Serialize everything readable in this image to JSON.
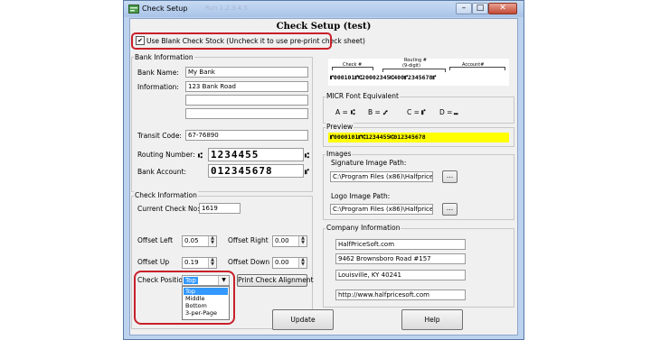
{
  "window": {
    "title": "Check Setup",
    "bg_text": "Run  1.2.3.4.5",
    "minimize": "–",
    "maximize": "□",
    "close": "✕"
  },
  "heading": "Check Setup (test)",
  "blank_stock": {
    "checked_mark": "✔",
    "label": "Use Blank Check Stock (Uncheck it to use pre-print check sheet)"
  },
  "bank": {
    "group_label": "Bank Information",
    "name_label": "Bank Name:",
    "name_value": "My Bank",
    "info_label": "Information:",
    "info_lines": [
      "123 Bank Road",
      "",
      ""
    ],
    "transit_label": "Transit Code:",
    "transit_value": "67-76890",
    "routing_label": "Routing Number:",
    "routing_prefix": "⑆",
    "routing_value": "1234455",
    "routing_suffix": "⑆",
    "account_label": "Bank Account:",
    "account_value": "012345678",
    "account_suffix": "⑈"
  },
  "micr_sample": {
    "check_label": "Check #",
    "routing_label": "Routing #",
    "routing_sub": "(9-digit)",
    "account_label": "Account#",
    "sample_text": "⑈000101⑈⑆20002345⑆400⑈2345678⑈"
  },
  "micr_font": {
    "group_label": "MICR Font Equivalent",
    "items": [
      {
        "letter": "A =",
        "symbol": "⑆"
      },
      {
        "letter": "B =",
        "symbol": "⑇"
      },
      {
        "letter": "C =",
        "symbol": "⑈"
      },
      {
        "letter": "D =",
        "symbol": "⑉"
      }
    ]
  },
  "preview": {
    "group_label": "Preview",
    "text": "⑈0000101⑈⑆1234455⑆012345678"
  },
  "images": {
    "group_label": "Images",
    "signature_label": "Signature Image Path:",
    "signature_path": "C:\\Program Files (x86)\\Halfpricesoft\\e",
    "logo_label": "Logo Image Path:",
    "logo_path": "C:\\Program Files (x86)\\Halfpricesoft\\e",
    "browse_label": "..."
  },
  "check_info": {
    "group_label": "Check Information",
    "current_label": "Current Check No:",
    "current_value": "1619",
    "offset_left_label": "Offset Left",
    "offset_left_value": "0.05",
    "offset_right_label": "Offset Right",
    "offset_right_value": "0.00",
    "offset_up_label": "Offset Up",
    "offset_up_value": "0.19",
    "offset_down_label": "Offset Down",
    "offset_down_value": "0.00",
    "position_label": "Check Position",
    "position_selected": "Top",
    "position_options": [
      "Top",
      "Middle",
      "Bottom",
      "3-per-Page"
    ],
    "align_button": "Print Check Alignment"
  },
  "company": {
    "group_label": "Company Information",
    "lines": [
      "HalfPriceSoft.com",
      "9462 Brownsboro Road #157",
      "Louisville, KY 40241",
      "http://www.halfpricesoft.com"
    ]
  },
  "buttons": {
    "update": "Update",
    "help": "Help"
  },
  "colors": {
    "title_bar": "#a9c4e8",
    "preview_bg": "#ffff00",
    "highlight_border": "#c8202a",
    "list_selection": "#3399ff"
  },
  "icons": {
    "app": "checkbook-icon",
    "spin": "spin-arrows-icon",
    "dropdown": "chevron-down-icon"
  }
}
